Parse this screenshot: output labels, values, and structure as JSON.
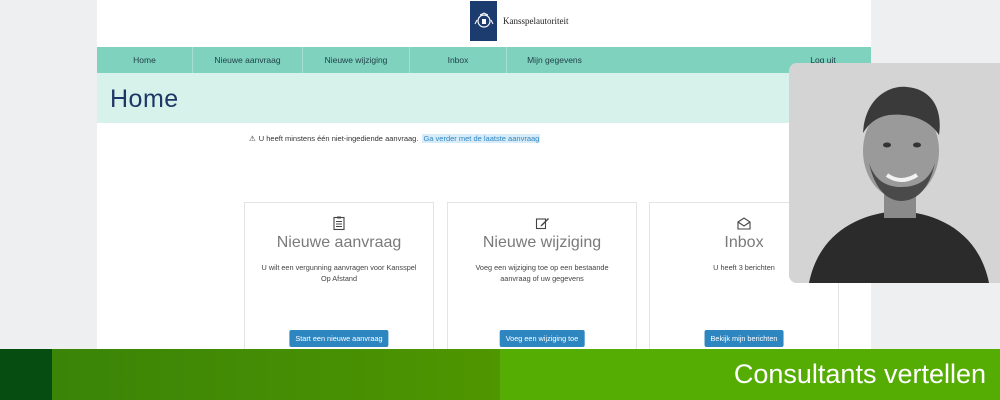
{
  "header": {
    "logo_text": "Kansspelautoriteit",
    "logo_icon": "royal-coat-of-arms-icon"
  },
  "nav": {
    "items": [
      "Home",
      "Nieuwe aanvraag",
      "Nieuwe wijziging",
      "Inbox",
      "Mijn gegevens"
    ],
    "logout": "Log uit"
  },
  "page": {
    "title": "Home"
  },
  "notice": {
    "text": "U heeft minstens één niet-ingediende aanvraag.",
    "link": "Ga verder met de laatste aanvraag",
    "icon": "warning-icon"
  },
  "cards": [
    {
      "title": "Nieuwe aanvraag",
      "desc": "U wilt een vergunning aanvragen voor Kansspel Op Afstand",
      "button": "Start een nieuwe aanvraag",
      "icon": "clipboard-list-icon"
    },
    {
      "title": "Nieuwe wijziging",
      "desc": "Voeg een wijziging toe op een bestaande aanvraag of uw gegevens",
      "button": "Voeg een wijziging toe",
      "icon": "edit-icon"
    },
    {
      "title": "Inbox",
      "desc": "U heeft 3 berichten",
      "button": "Bekijk mijn berichten",
      "icon": "envelope-open-icon"
    }
  ],
  "banner": {
    "text": "Consultants vertellen"
  },
  "colors": {
    "nav": "#7fd2bd",
    "title_bar": "#d6f2ea",
    "button": "#2e86c1",
    "banner_green": "#55ad04",
    "banner_dark": "#064d12"
  }
}
